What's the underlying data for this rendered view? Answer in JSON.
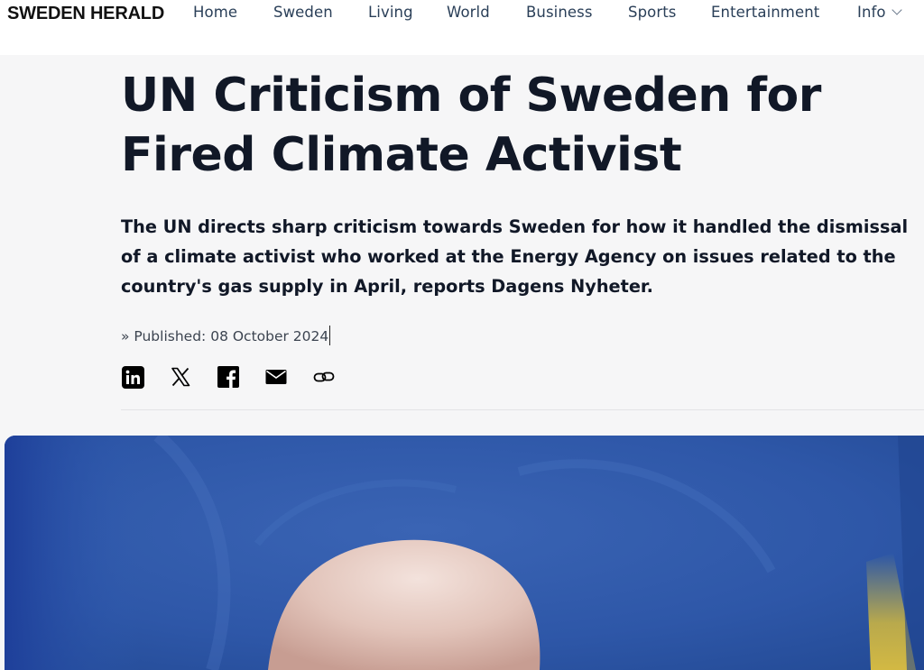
{
  "site": {
    "logo": "SWEDEN HERALD"
  },
  "nav": {
    "items": [
      {
        "label": "Home"
      },
      {
        "label": "Sweden"
      },
      {
        "label": "Living"
      },
      {
        "label": "World"
      },
      {
        "label": "Business"
      },
      {
        "label": "Sports"
      },
      {
        "label": "Entertainment"
      },
      {
        "label": "Info"
      }
    ]
  },
  "article": {
    "title": "UN Criticism of Sweden for Fired Climate Activist",
    "lede": "The UN directs sharp criticism towards Sweden for how it handled the dismissal of a climate activist who worked at the Energy Agency on issues related to the country's gas supply in April, reports Dagens Nyheter.",
    "published_prefix": "» Published:",
    "published_date": "08 October 2024"
  },
  "share": {
    "icons": [
      "linkedin-icon",
      "x-icon",
      "facebook-icon",
      "email-icon",
      "link-icon"
    ]
  },
  "colors": {
    "background": "#f6f6f7",
    "header_bg": "#ffffff",
    "title": "#111827",
    "nav_text": "#2a3f58",
    "hero_blue": "#2a55a6",
    "flag_yellow": "#e6c53a"
  }
}
